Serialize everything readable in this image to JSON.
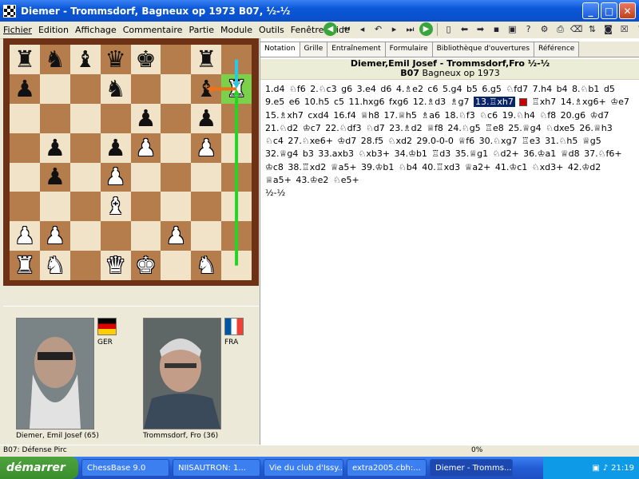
{
  "window": {
    "title": "Diemer - Trommsdorf, Bagneux op 1973  B07, ½-½"
  },
  "menu": [
    "Fichier",
    "Edition",
    "Affichage",
    "Commentaire",
    "Partie",
    "Module",
    "Outils",
    "Fenêtre",
    "Aide"
  ],
  "board": {
    "rows": [
      [
        "r",
        "n",
        "b",
        "q",
        "k",
        "",
        "r",
        ""
      ],
      [
        "p",
        "",
        "",
        "n",
        "",
        "",
        "b",
        "R"
      ],
      [
        "",
        "",
        "",
        "",
        "p",
        "",
        "p",
        ""
      ],
      [
        "",
        "p",
        "",
        "p",
        "P",
        "",
        "P",
        ""
      ],
      [
        "",
        "p",
        "",
        "P",
        "",
        "",
        "",
        ""
      ],
      [
        "",
        "",
        "",
        "B",
        "",
        "",
        "",
        ""
      ],
      [
        "P",
        "P",
        "",
        "",
        "",
        "P",
        "",
        ""
      ],
      [
        "R",
        "N",
        "",
        "Q",
        "K",
        "",
        "N",
        ""
      ]
    ],
    "highlight": "h7",
    "arrows": [
      {
        "from": "h1",
        "to": "h7",
        "color": "#26d426"
      },
      {
        "from": "h7",
        "to": "g7",
        "color": "#f07016"
      },
      {
        "from": "h8",
        "to": "h7",
        "color": "#2ac8e8"
      }
    ]
  },
  "players": {
    "white": {
      "name": "Diemer, Emil Josef  (65)",
      "country": "GER"
    },
    "black": {
      "name": "Trommsdorf, Fro  (36)",
      "country": "FRA"
    }
  },
  "tabs": [
    "Notation",
    "Grille",
    "Entraînement",
    "Formulaire",
    "Bibliothèque d'ouvertures",
    "Référence"
  ],
  "game": {
    "header_line1": "Diemer,Emil Josef - Trommsdorf,Fro  ½-½",
    "header_eco": "B07",
    "header_event": "Bagneux op 1973",
    "moves_before": "1.d4 ♘f6 2.♘c3 g6 3.e4 d6 4.♗e2 c6 5.g4 b5 6.g5 ♘fd7 7.h4 b4 8.♘b1 d5 9.e5 e6 10.h5 c5 11.hxg6 fxg6 12.♗d3 ♗g7",
    "current_move": "13.♖xh7",
    "moves_after": "♖xh7 14.♗xg6+ ♔e7 15.♗xh7 cxd4 16.f4 ♕h8 17.♕h5 ♗a6 18.♘f3 ♘c6 19.♘h4 ♘f8 20.g6 ♔d7 21.♘d2 ♔c7 22.♘df3 ♘d7 23.♗d2 ♕f8 24.♘g5 ♖e8 25.♕g4 ♘dxe5 26.♕h3 ♘c4 27.♘xe6+ ♔d7 28.f5 ♘xd2 29.0-0-0 ♕f6 30.♘xg7 ♖e3 31.♘h5 ♕g5 32.♕g4 b3 33.axb3 ♘xb3+ 34.♔b1 ♖d3 35.♕g1 ♘d2+ 36.♔a1 ♕d8 37.♘f6+ ♔c8 38.♖xd2 ♕a5+ 39.♔b1 ♘b4 40.♖xd3 ♕a2+ 41.♔c1 ♘xd3+ 42.♔d2 ♕a5+ 43.♔e2 ♘e5+",
    "result": "½-½"
  },
  "status": {
    "opening": "B07: Défense Pirc",
    "progress": "0%"
  },
  "taskbar": {
    "start": "démarrer",
    "tasks": [
      "ChessBase 9.0",
      "NIISAUTRON: 1...",
      "Vie du club d'Issy...",
      "extra2005.cbh:...",
      "Diemer - Tromms..."
    ],
    "clock": "21:19"
  }
}
